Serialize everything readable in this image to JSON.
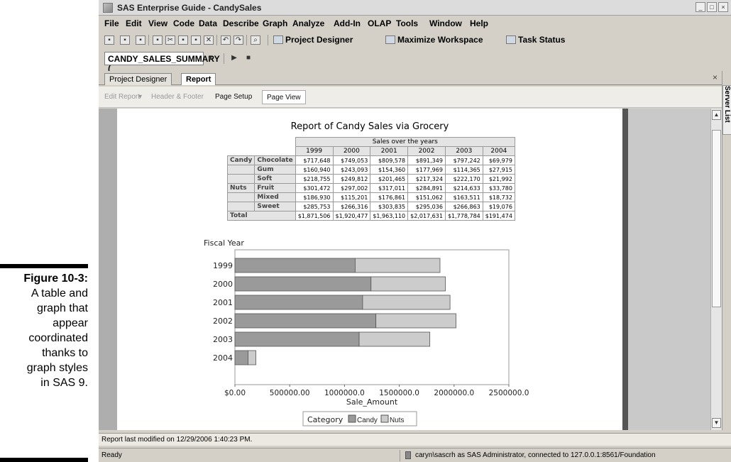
{
  "book": {
    "figure_label": "Figure 10-3:",
    "caption_lines": [
      "A table and",
      "graph that",
      "appear",
      "coordinated",
      "thanks to",
      "graph styles",
      "in SAS 9."
    ]
  },
  "window": {
    "title": "SAS Enterprise Guide - CandySales"
  },
  "menu": [
    "File",
    "Edit",
    "View",
    "Code",
    "Data",
    "Describe",
    "Graph",
    "Analyze",
    "Add-In",
    "OLAP",
    "Tools",
    "Window",
    "Help"
  ],
  "toolbar": {
    "project_designer": "Project Designer",
    "maximize_workspace": "Maximize Workspace",
    "task_status": "Task Status"
  },
  "dataset": {
    "name": "CANDY_SALES_SUMMARY ("
  },
  "tabs": {
    "project_designer": "Project Designer",
    "report": "Report"
  },
  "report_toolbar": {
    "edit_report": "Edit Report",
    "header_footer": "Header & Footer",
    "page_setup": "Page Setup",
    "page_view": "Page View"
  },
  "side_panel": {
    "label": "Server List"
  },
  "report": {
    "title": "Report of Candy Sales via Grocery",
    "table": {
      "group_header": "Sales over the years",
      "years": [
        "1999",
        "2000",
        "2001",
        "2002",
        "2003",
        "2004"
      ],
      "rows": [
        {
          "category": "Candy",
          "product": "Chocolate",
          "values": [
            "$717,648",
            "$749,053",
            "$809,578",
            "$891,349",
            "$797,242",
            "$69,979"
          ]
        },
        {
          "category": "",
          "product": "Gum",
          "values": [
            "$160,940",
            "$243,093",
            "$154,360",
            "$177,969",
            "$114,365",
            "$27,915"
          ]
        },
        {
          "category": "",
          "product": "Soft",
          "values": [
            "$218,755",
            "$249,812",
            "$201,465",
            "$217,324",
            "$222,170",
            "$21,992"
          ]
        },
        {
          "category": "Nuts",
          "product": "Fruit",
          "values": [
            "$301,472",
            "$297,002",
            "$317,011",
            "$284,891",
            "$214,633",
            "$33,780"
          ]
        },
        {
          "category": "",
          "product": "Mixed",
          "values": [
            "$186,930",
            "$115,201",
            "$176,861",
            "$151,062",
            "$163,511",
            "$18,732"
          ]
        },
        {
          "category": "",
          "product": "Sweet",
          "values": [
            "$285,753",
            "$266,316",
            "$303,835",
            "$295,036",
            "$266,863",
            "$19,076"
          ]
        }
      ],
      "total": {
        "label": "Total",
        "values": [
          "$1,871,506",
          "$1,920,477",
          "$1,963,110",
          "$2,017,631",
          "$1,778,784",
          "$191,474"
        ]
      }
    }
  },
  "chart_data": {
    "type": "bar",
    "orientation": "horizontal",
    "stacked": true,
    "categories": [
      "1999",
      "2000",
      "2001",
      "2002",
      "2003",
      "2004"
    ],
    "series": [
      {
        "name": "Candy",
        "values": [
          1097343,
          1241958,
          1165403,
          1286642,
          1133777,
          119886
        ],
        "color": "#9a9a9a"
      },
      {
        "name": "Nuts",
        "values": [
          774155,
          678519,
          797707,
          730989,
          645007,
          71588
        ],
        "color": "#cccccc"
      }
    ],
    "ylabel": "Fiscal Year",
    "xlabel": "Sale_Amount",
    "xlim": [
      0,
      2500000
    ],
    "xticks": [
      "$0.00",
      "500000.00",
      "1000000.0",
      "1500000.0",
      "2000000.0",
      "2500000.0"
    ],
    "legend_title": "Category",
    "legend": "bottom"
  },
  "status": {
    "report_modified": "Report last modified on 12/29/2006 1:40:23 PM.",
    "ready": "Ready",
    "connection": "caryn\\sascrh as SAS Administrator, connected to 127.0.0.1:8561/Foundation"
  }
}
